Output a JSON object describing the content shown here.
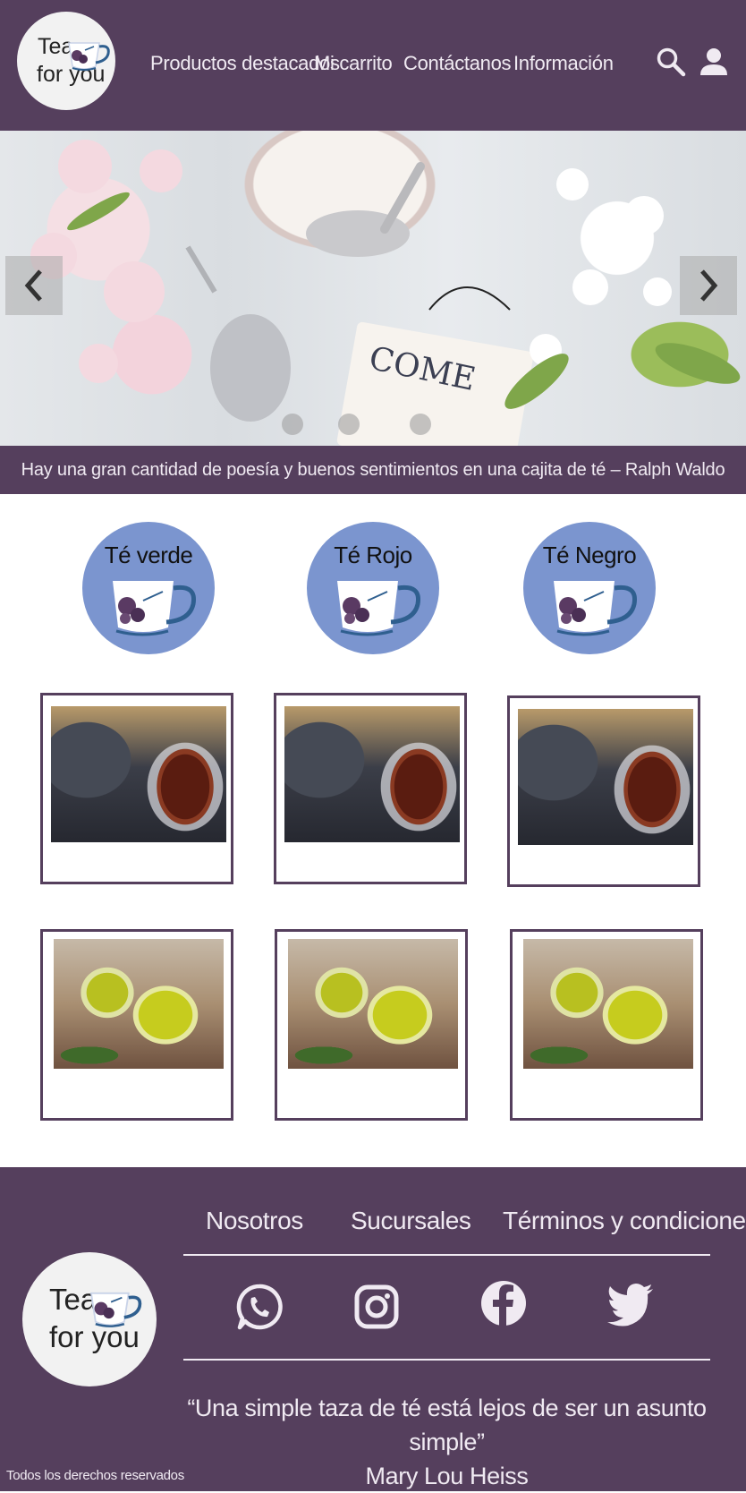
{
  "header": {
    "logo": {
      "line1": "Tea",
      "line2": "for you"
    },
    "nav": [
      "Productos destacados",
      "Mi carrito",
      "Contáctanos",
      "Información"
    ],
    "icons": [
      "search-icon",
      "user-icon"
    ]
  },
  "carousel": {
    "sign_text": "COME",
    "prev_icon": "chevron-left-icon",
    "next_icon": "chevron-right-icon",
    "slide_count": 3
  },
  "quote_bar": {
    "text": "Hay una gran cantidad de poesía y buenos sentimientos en una cajita de té – Ralph Waldo"
  },
  "categories": [
    {
      "label": "Té verde"
    },
    {
      "label": "Té Rojo"
    },
    {
      "label": "Té Negro"
    }
  ],
  "colors": {
    "primary": "#553f5d",
    "category_bg": "#7b95cf",
    "light": "#f0eaf2"
  },
  "footer": {
    "links": [
      "Nosotros",
      "Sucursales",
      "Términos y condiciones"
    ],
    "social": [
      "whatsapp-icon",
      "instagram-icon",
      "facebook-icon",
      "twitter-icon"
    ],
    "logo": {
      "line1": "Tea",
      "line2": "for you"
    },
    "quote_line1": "“Una simple taza de té está lejos de ser un asunto simple”",
    "quote_line2": "Mary Lou Heiss",
    "rights": "Todos los derechos reservados"
  }
}
